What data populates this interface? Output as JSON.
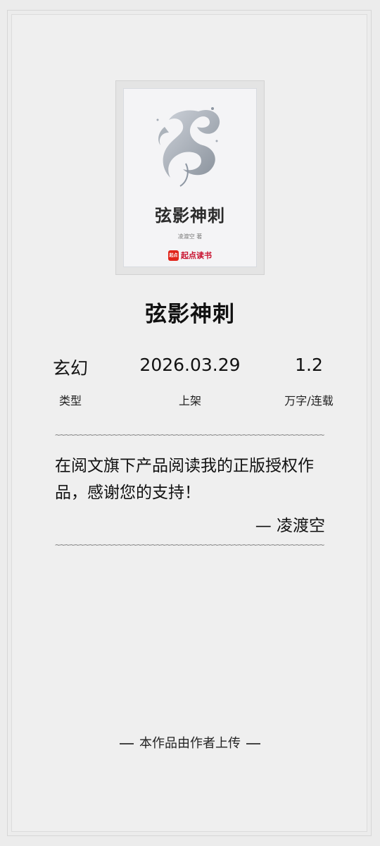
{
  "cover": {
    "title": "弦影神刺",
    "author_byline": "凌渡空 著",
    "brand_logo": "起点",
    "brand_name": "起点读书",
    "art_icon": "dragon-ink-art"
  },
  "book": {
    "title": "弦影神刺"
  },
  "stats": [
    {
      "value": "玄幻",
      "label": "类型"
    },
    {
      "value": "2026.03.29",
      "label": "上架"
    },
    {
      "value": "1.2",
      "label": "万字/连载"
    }
  ],
  "divider_text": "~~~~~~~~~~~~~~~~~~~~~~~~~~~~~~~~~~~~~~~~~~~~~~~~~~~~~~~~",
  "message": {
    "text": "在阅文旗下产品阅读我的正版授权作品，感谢您的支持！",
    "signature": "— 凌渡空"
  },
  "footer": {
    "note": "本作品由作者上传"
  },
  "colors": {
    "background": "#ececec",
    "brand_red": "#e1251b"
  }
}
